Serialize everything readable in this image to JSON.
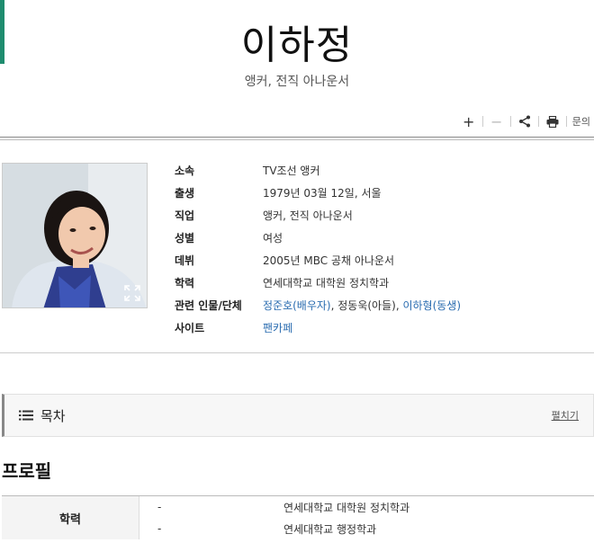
{
  "header": {
    "title": "이하정",
    "subtitle": "앵커, 전직 아나운서"
  },
  "toolbar": {
    "add_icon": "+",
    "remove_icon": "−",
    "more_label": "문의"
  },
  "info": {
    "rows": [
      {
        "label": "소속",
        "value": "TV조선 앵커"
      },
      {
        "label": "출생",
        "value": "1979년 03월 12일, 서울"
      },
      {
        "label": "직업",
        "value": "앵커, 전직 아나운서"
      },
      {
        "label": "성별",
        "value": "여성"
      },
      {
        "label": "데뷔",
        "value": "2005년 MBC 공채 아나운서"
      },
      {
        "label": "학력",
        "value": "연세대학교 대학원 정치학과"
      }
    ],
    "relations_label": "관련 인물/단체",
    "relations": {
      "spouse": "정준호(배우자)",
      "sep1": ", ",
      "son": "정동욱(아들)",
      "sep2": ", ",
      "sibling": "이하형(동생)"
    },
    "site_label": "사이트",
    "site_value": "팬카페"
  },
  "toc": {
    "label": "목차",
    "toggle": "펼치기"
  },
  "profile": {
    "title": "프로필",
    "rows": [
      {
        "head": "학력",
        "date": "-",
        "desc": "연세대학교 대학원 정치학과"
      },
      {
        "head": "",
        "date": "-",
        "desc": "연세대학교 행정학과"
      }
    ]
  },
  "colors": {
    "accent": "#1e8c6e",
    "link": "#2a6cb0"
  }
}
